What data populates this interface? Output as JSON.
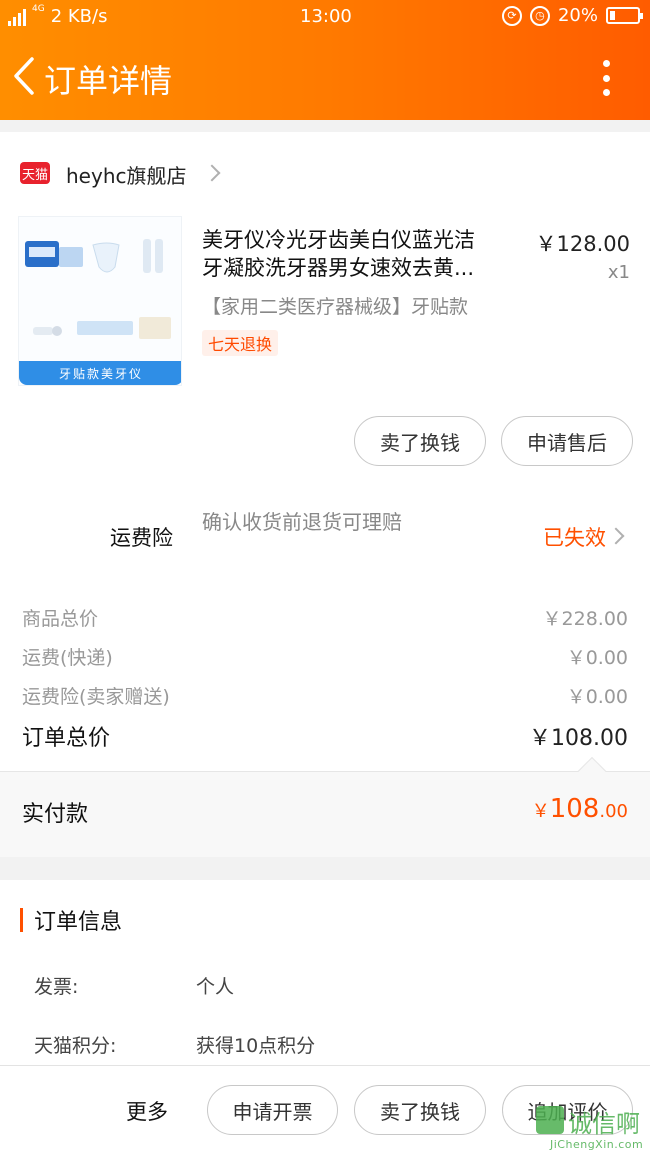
{
  "status_bar": {
    "network": "4G",
    "speed": "2 KB/s",
    "time": "13:00",
    "battery": "20%",
    "battery_level": 0.2
  },
  "header": {
    "title": "订单详情"
  },
  "store": {
    "badge": "天猫",
    "name": "heyhc旗舰店"
  },
  "product": {
    "title_line1": "美牙仪冷光牙齿美白仪蓝光洁",
    "title_line2": "牙凝胶洗牙器男女速效去黄...",
    "spec": "【家用二类医疗器械级】牙贴款",
    "tag": "七天退换",
    "price": "￥128.00",
    "qty": "x1",
    "thumb_band_text": "牙贴款美牙仪"
  },
  "product_actions": {
    "sell": "卖了换钱",
    "after_sale": "申请售后"
  },
  "insurance": {
    "label": "运费险",
    "desc": "确认收货前退货可理赔",
    "status": "已失效"
  },
  "prices": {
    "items": [
      {
        "label": "商品总价",
        "value": "￥228.00"
      },
      {
        "label": "运费(快递)",
        "value": "￥0.00"
      },
      {
        "label": "运费险(卖家赠送)",
        "value": "￥0.00"
      }
    ],
    "total_label": "订单总价",
    "total_value": "￥108.00"
  },
  "paid": {
    "label": "实付款",
    "currency": "￥",
    "main": "108",
    "decimals": ".00"
  },
  "order_info": {
    "title": "订单信息",
    "rows": [
      {
        "label": "发票:",
        "value": "个人"
      },
      {
        "label": "天猫积分:",
        "value": "获得10点积分"
      }
    ]
  },
  "bottom_bar": {
    "more": "更多",
    "invoice": "申请开票",
    "sell": "卖了换钱",
    "review": "追加评价"
  },
  "watermark": {
    "cn": "诚信啊",
    "en": "JiChengXin.com"
  },
  "colors": {
    "accent": "#ff5000",
    "header_start": "#ff8e00",
    "header_end": "#ff5c00",
    "tmall_red": "#e8222d"
  }
}
